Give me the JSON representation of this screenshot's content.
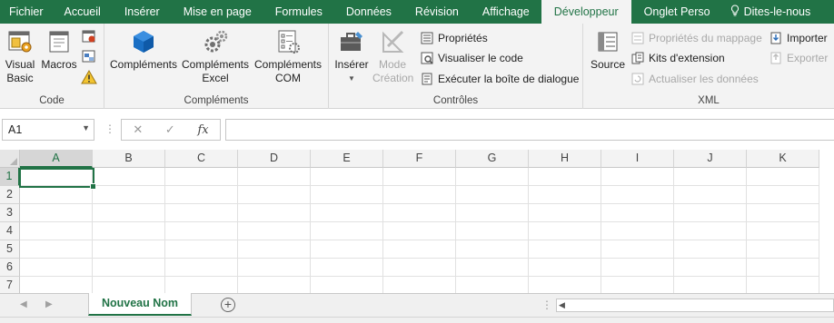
{
  "tabs": [
    {
      "label": "Fichier",
      "active": false
    },
    {
      "label": "Accueil",
      "active": false
    },
    {
      "label": "Insérer",
      "active": false
    },
    {
      "label": "Mise en page",
      "active": false
    },
    {
      "label": "Formules",
      "active": false
    },
    {
      "label": "Données",
      "active": false
    },
    {
      "label": "Révision",
      "active": false
    },
    {
      "label": "Affichage",
      "active": false
    },
    {
      "label": "Développeur",
      "active": true
    },
    {
      "label": "Onglet Perso",
      "active": false
    },
    {
      "label": "Dites-le-nous",
      "active": false
    }
  ],
  "ribbon": {
    "code": {
      "label": "Code",
      "visual_basic": "Visual Basic",
      "macros": "Macros"
    },
    "complements": {
      "label": "Compléments",
      "complements": "Compléments",
      "excel": "Compléments Excel",
      "com": "Compléments COM"
    },
    "controles": {
      "label": "Contrôles",
      "inserer": "Insérer",
      "mode_creation": "Mode Création",
      "proprietes": "Propriétés",
      "visualiser": "Visualiser le code",
      "executer": "Exécuter la boîte de dialogue"
    },
    "xml": {
      "label": "XML",
      "source": "Source",
      "proprietes_mappage": "Propriétés du mappage",
      "kits": "Kits d'extension",
      "actualiser": "Actualiser les données",
      "importer": "Importer",
      "exporter": "Exporter"
    }
  },
  "formula_bar": {
    "name_box": "A1",
    "formula": ""
  },
  "columns": [
    "A",
    "B",
    "C",
    "D",
    "E",
    "F",
    "G",
    "H",
    "I",
    "J",
    "K"
  ],
  "rows": [
    "1",
    "2",
    "3",
    "4",
    "5",
    "6",
    "7"
  ],
  "active_cell": "A1",
  "sheets": [
    {
      "label": "Nouveau Nom",
      "active": true
    }
  ],
  "colors": {
    "accent": "#217346",
    "ribbon_bg": "#f3f3f3",
    "disabled_text": "#a8a8a8"
  }
}
